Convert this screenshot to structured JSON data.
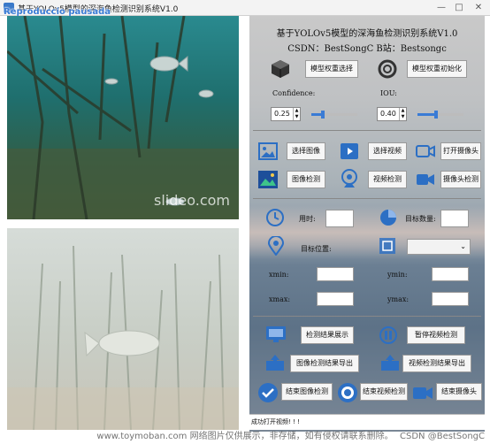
{
  "window": {
    "title": "基于YOLOv5模型的深海鱼检测识别系统V1.0",
    "overlay_text": "Reproduccio pausada",
    "minimize": "—",
    "maximize": "□",
    "close": "✕"
  },
  "panel": {
    "heading": "基于YOLOv5模型的深海鱼检测识别系统V1.0",
    "csdn": "CSDN：BestSongC  B站：Bestsongc",
    "select_weights": "模型权重选择",
    "init_weights": "模型权重初始化",
    "confidence_label": "Confidence:",
    "iou_label": "IOU:",
    "confidence_value": "0.25",
    "iou_value": "0.40",
    "confidence_level": 0.25,
    "iou_level": 0.4,
    "select_image": "选择图像",
    "select_video": "选择视频",
    "open_camera": "打开摄像头",
    "image_detect": "图像检测",
    "video_detect": "视频检测",
    "camera_detect": "摄像头检测",
    "time_label": "用时:",
    "count_label": "目标数量:",
    "pos_label": "目标位置:",
    "xmin": "xmin:",
    "ymin": "ymin:",
    "xmax": "xmax:",
    "ymax": "ymax:",
    "show_results": "检测结果展示",
    "pause_video": "暂停视频检测",
    "export_image": "图像检测结果导出",
    "export_video": "视频检测结果导出",
    "end_image": "结束图像检测",
    "end_video": "结束视频检测",
    "end_camera": "结束摄像头",
    "status": "成功打开视频! ! !"
  },
  "video": {
    "watermark": "slideo.com"
  },
  "footer": {
    "watermark": "www.toymoban.com 网络图片仅供展示，非存储，如有侵权请联系删除。",
    "csdn": "CSDN @BestSongC"
  },
  "colors": {
    "accent": "#3a7bd5",
    "panel_top": "#c9c9c9",
    "panel_bottom": "#5d7287"
  }
}
